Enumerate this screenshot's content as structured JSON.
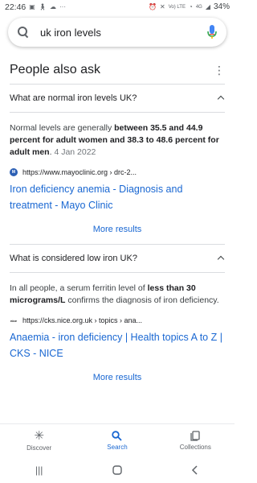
{
  "status_bar": {
    "time": "22:46",
    "battery": "34%",
    "network_label": "Vo) LTE",
    "signal_label": "4G"
  },
  "search": {
    "query": "uk iron levels"
  },
  "paa": {
    "title": "People also ask",
    "questions": [
      {
        "question": "What are normal iron levels UK?",
        "answer_parts": [
          {
            "text": "Normal levels are generally ",
            "bold": false
          },
          {
            "text": "between 35.5 and 44.9 percent for adult women and 38.3 to 48.6 percent for adult men",
            "bold": true
          },
          {
            "text": ". ",
            "bold": false
          }
        ],
        "date": "4 Jan 2022",
        "source_url": "https://www.mayoclinic.org › drc-2...",
        "link_title": "Iron deficiency anemia - Diagnosis and treatment - Mayo Clinic",
        "more_label": "More results"
      },
      {
        "question": "What is considered low iron UK?",
        "answer_parts": [
          {
            "text": "In all people, a serum ferritin level of ",
            "bold": false
          },
          {
            "text": "less than 30 micrograms/L",
            "bold": true
          },
          {
            "text": " confirms the diagnosis of iron deficiency.",
            "bold": false
          }
        ],
        "date": "",
        "source_url": "https://cks.nice.org.uk › topics › ana...",
        "link_title": "Anaemia - iron deficiency | Health topics A to Z | CKS - NICE",
        "more_label": "More results"
      }
    ]
  },
  "bottom_nav": {
    "items": [
      {
        "label": "Discover",
        "icon": "asterisk-icon"
      },
      {
        "label": "Search",
        "icon": "search-icon"
      },
      {
        "label": "Collections",
        "icon": "collections-icon"
      }
    ],
    "active_index": 1
  },
  "colors": {
    "accent": "#1967d2",
    "text": "#202124",
    "divider": "#dadce0"
  }
}
